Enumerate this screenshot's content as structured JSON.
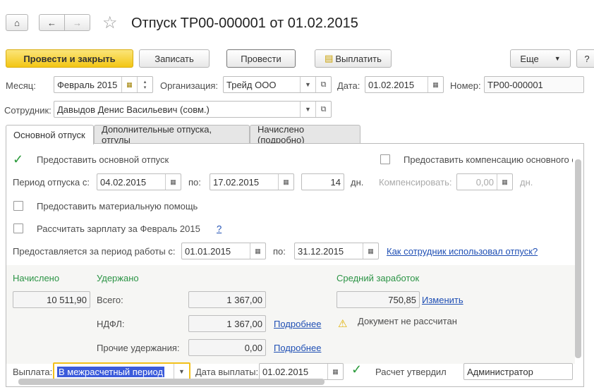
{
  "header": {
    "title": "Отпуск ТР00-000001 от 01.02.2015"
  },
  "toolbar": {
    "post_close": "Провести и закрыть",
    "save": "Записать",
    "post": "Провести",
    "pay": "Выплатить",
    "more": "Еще",
    "help": "?"
  },
  "fields": {
    "month_label": "Месяц:",
    "month": "Февраль 2015",
    "org_label": "Организация:",
    "org": "Трейд ООО",
    "date_label": "Дата:",
    "date": "01.02.2015",
    "number_label": "Номер:",
    "number": "ТР00-000001",
    "employee_label": "Сотрудник:",
    "employee": "Давыдов Денис Васильевич (совм.)"
  },
  "tabs": [
    {
      "label": "Основной отпуск"
    },
    {
      "label": "Дополнительные отпуска, отгулы"
    },
    {
      "label": "Начислено (подробно)"
    }
  ],
  "main": {
    "grant_main": "Предоставить основной отпуск",
    "grant_comp": "Предоставить компенсацию основного о",
    "period_label": "Период отпуска с:",
    "period_from": "04.02.2015",
    "to_label": "по:",
    "period_to": "17.02.2015",
    "days": "14",
    "days_unit": "дн.",
    "compensate_label": "Компенсировать:",
    "compensate": "0,00",
    "compensate_unit": "дн.",
    "material": "Предоставить материальную помощь",
    "salary": "Рассчитать зарплату за Февраль 2015",
    "salary_help": "?",
    "work_period_label": "Предоставляется за период работы с:",
    "work_from": "01.01.2015",
    "work_to_label": "по:",
    "work_to": "31.12.2015",
    "usage_link": "Как сотрудник использовал отпуск?",
    "accrued_label": "Начислено",
    "accrued": "10 511,90",
    "withheld_label": "Удержано",
    "total_label": "Всего:",
    "total": "1 367,00",
    "ndfl_label": "НДФЛ:",
    "ndfl": "1 367,00",
    "details": "Подробнее",
    "other_label": "Прочие удержания:",
    "other": "0,00",
    "avg_label": "Средний заработок",
    "avg": "750,85",
    "change": "Изменить",
    "warning": "Документ не рассчитан",
    "payout_label": "Выплата:",
    "payout": "В межрасчетный период",
    "paydate_label": "Дата выплаты:",
    "paydate": "01.02.2015",
    "approved_label": "Расчет утвердил",
    "approved": "Администратор"
  }
}
